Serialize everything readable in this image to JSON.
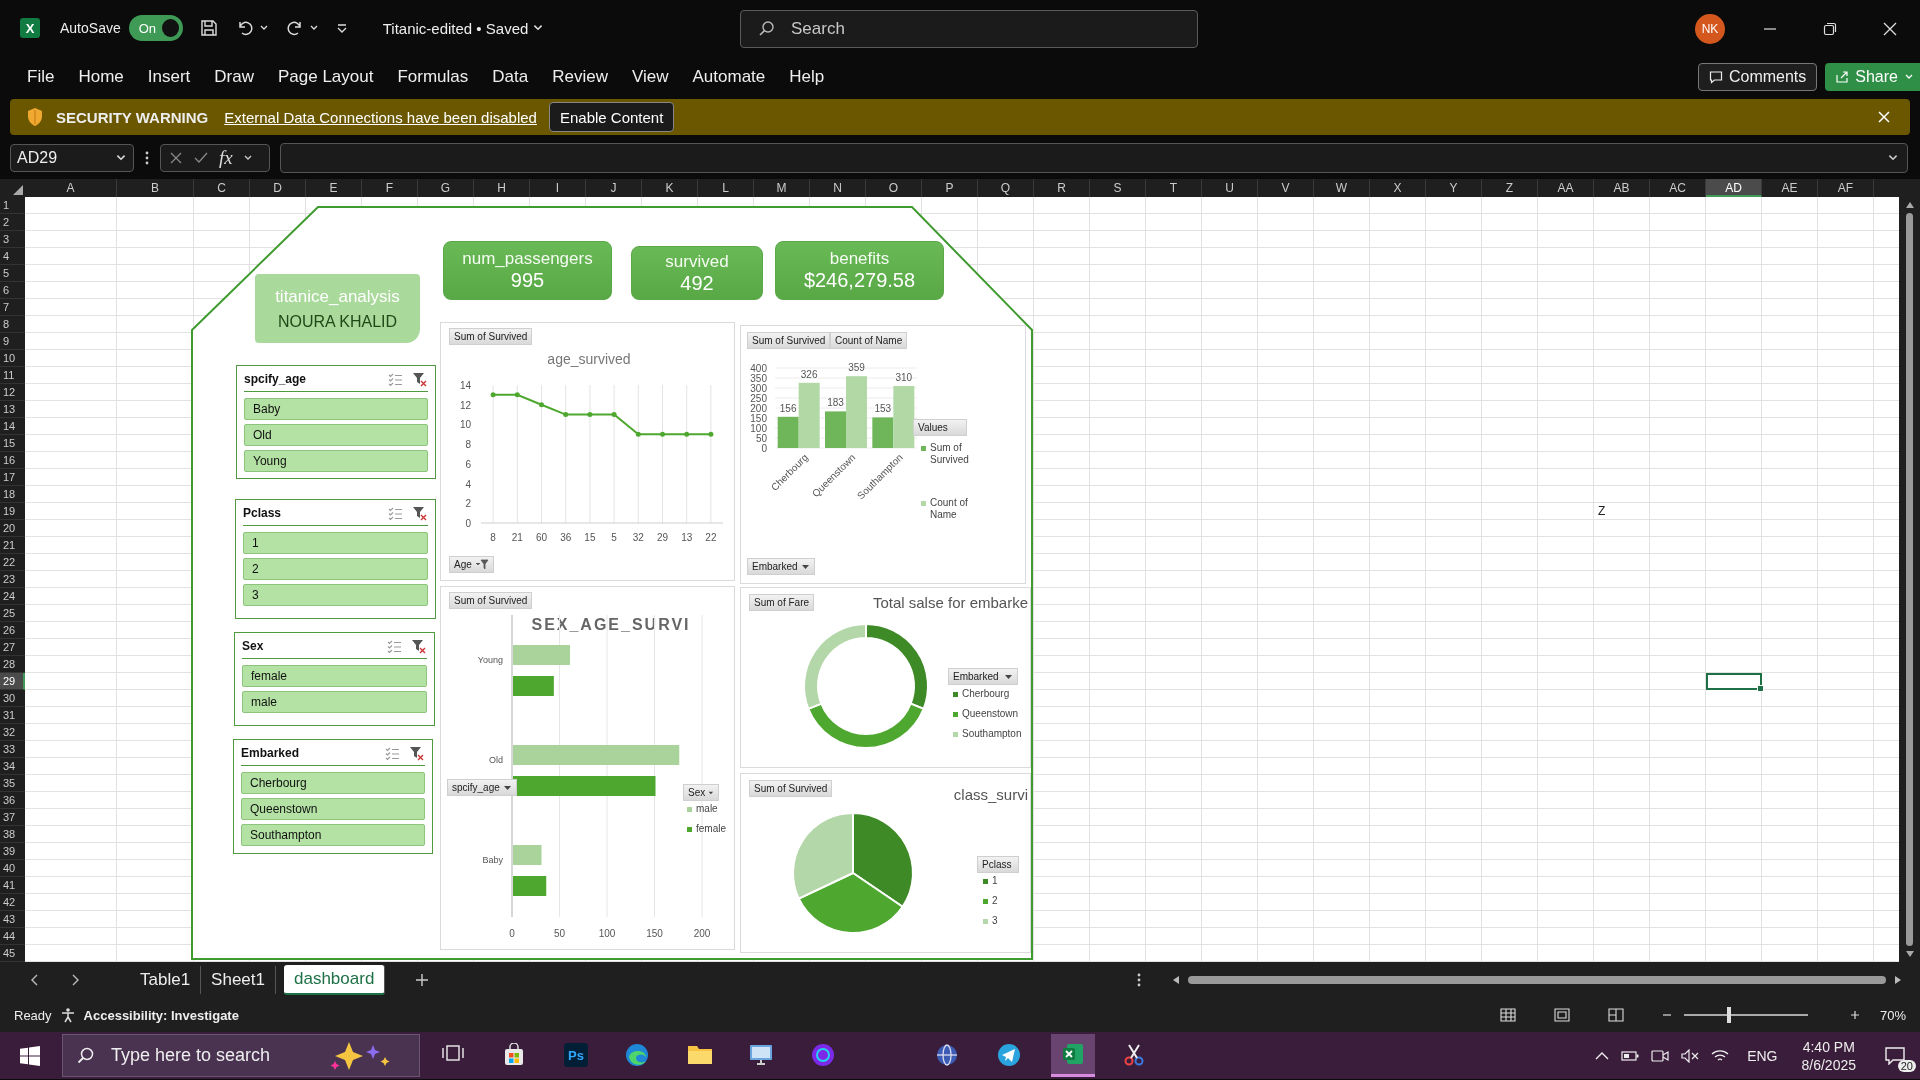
{
  "title_bar": {
    "app_icon_text": "X",
    "autosave": {
      "label": "AutoSave",
      "toggle_text": "On",
      "on": true
    },
    "document_title": "Titanic-edited • Saved",
    "search": {
      "placeholder": "Search"
    },
    "avatar": "NK"
  },
  "menu": [
    "File",
    "Home",
    "Insert",
    "Draw",
    "Page Layout",
    "Formulas",
    "Data",
    "Review",
    "View",
    "Automate",
    "Help"
  ],
  "menu_buttons": {
    "comments": "Comments",
    "share": "Share"
  },
  "security_warning": {
    "title": "SECURITY WARNING",
    "message": "External Data Connections have been disabled",
    "button": "Enable Content"
  },
  "formula_bar": {
    "name_box": "AD29",
    "function_label": "fx"
  },
  "columns": [
    {
      "label": "A",
      "selected": false
    },
    {
      "label": "B",
      "selected": false
    },
    {
      "label": "C",
      "selected": false
    },
    {
      "label": "D",
      "selected": false
    },
    {
      "label": "E",
      "selected": false
    },
    {
      "label": "F",
      "selected": false
    },
    {
      "label": "G",
      "selected": false
    },
    {
      "label": "H",
      "selected": false
    },
    {
      "label": "I",
      "selected": false
    },
    {
      "label": "J",
      "selected": false
    },
    {
      "label": "K",
      "selected": false
    },
    {
      "label": "L",
      "selected": false
    },
    {
      "label": "M",
      "selected": false
    },
    {
      "label": "N",
      "selected": false
    },
    {
      "label": "O",
      "selected": false
    },
    {
      "label": "P",
      "selected": false
    },
    {
      "label": "Q",
      "selected": false
    },
    {
      "label": "R",
      "selected": false
    },
    {
      "label": "S",
      "selected": false
    },
    {
      "label": "T",
      "selected": false
    },
    {
      "label": "U",
      "selected": false
    },
    {
      "label": "V",
      "selected": false
    },
    {
      "label": "W",
      "selected": false
    },
    {
      "label": "X",
      "selected": false
    },
    {
      "label": "Y",
      "selected": false
    },
    {
      "label": "Z",
      "selected": false
    },
    {
      "label": "AA",
      "selected": false
    },
    {
      "label": "AB",
      "selected": false
    },
    {
      "label": "AC",
      "selected": false
    },
    {
      "label": "AD",
      "selected": true
    },
    {
      "label": "AE",
      "selected": false
    },
    {
      "label": "AF",
      "selected": false
    }
  ],
  "rows": [
    {
      "label": "1",
      "selected": false
    },
    {
      "label": "2",
      "selected": false
    },
    {
      "label": "3",
      "selected": false
    },
    {
      "label": "4",
      "selected": false
    },
    {
      "label": "5",
      "selected": false
    },
    {
      "label": "6",
      "selected": false
    },
    {
      "label": "7",
      "selected": false
    },
    {
      "label": "8",
      "selected": false
    },
    {
      "label": "9",
      "selected": false
    },
    {
      "label": "10",
      "selected": false
    },
    {
      "label": "11",
      "selected": false
    },
    {
      "label": "12",
      "selected": false
    },
    {
      "label": "13",
      "selected": false
    },
    {
      "label": "14",
      "selected": false
    },
    {
      "label": "15",
      "selected": false
    },
    {
      "label": "16",
      "selected": false
    },
    {
      "label": "17",
      "selected": false
    },
    {
      "label": "18",
      "selected": false
    },
    {
      "label": "19",
      "selected": false
    },
    {
      "label": "20",
      "selected": false
    },
    {
      "label": "21",
      "selected": false
    },
    {
      "label": "22",
      "selected": false
    },
    {
      "label": "23",
      "selected": false
    },
    {
      "label": "24",
      "selected": false
    },
    {
      "label": "25",
      "selected": false
    },
    {
      "label": "26",
      "selected": false
    },
    {
      "label": "27",
      "selected": false
    },
    {
      "label": "28",
      "selected": false
    },
    {
      "label": "29",
      "selected": true
    },
    {
      "label": "30",
      "selected": false
    },
    {
      "label": "31",
      "selected": false
    },
    {
      "label": "32",
      "selected": false
    },
    {
      "label": "33",
      "selected": false
    },
    {
      "label": "34",
      "selected": false
    },
    {
      "label": "35",
      "selected": false
    },
    {
      "label": "36",
      "selected": false
    },
    {
      "label": "37",
      "selected": false
    },
    {
      "label": "38",
      "selected": false
    },
    {
      "label": "39",
      "selected": false
    },
    {
      "label": "40",
      "selected": false
    },
    {
      "label": "41",
      "selected": false
    },
    {
      "label": "42",
      "selected": false
    },
    {
      "label": "43",
      "selected": false
    },
    {
      "label": "44",
      "selected": false
    },
    {
      "label": "45",
      "selected": false
    }
  ],
  "sheet_cells": [
    {
      "value": "Z"
    }
  ],
  "dashboard": {
    "title": "titanice_analysis",
    "author": "NOURA KHALID",
    "kpis": [
      {
        "label": "num_passengers",
        "value": "995"
      },
      {
        "label": "survived",
        "value": "492"
      },
      {
        "label": "benefits",
        "value": "$246,279.58"
      }
    ],
    "slicers": [
      {
        "title": "spcify_age",
        "items": [
          {
            "label": "Baby",
            "selected": true
          },
          {
            "label": "Old",
            "selected": true
          },
          {
            "label": "Young",
            "selected": true
          }
        ]
      },
      {
        "title": "Pclass",
        "items": [
          {
            "label": "1",
            "selected": true
          },
          {
            "label": "2",
            "selected": true
          },
          {
            "label": "3",
            "selected": true
          }
        ]
      },
      {
        "title": "Sex",
        "items": [
          {
            "label": "female",
            "selected": true
          },
          {
            "label": "male",
            "selected": true
          }
        ]
      },
      {
        "title": "Embarked",
        "items": [
          {
            "label": "Cherbourg",
            "selected": true
          },
          {
            "label": "Queenstown",
            "selected": true
          },
          {
            "label": "Southampton",
            "selected": true
          }
        ]
      }
    ]
  },
  "age_chart": {
    "axis_field": "Age",
    "chart_data": {
      "type": "line",
      "title": "age_survived",
      "grid": true,
      "categories": [
        "8",
        "21",
        "60",
        "36",
        "15",
        "5",
        "32",
        "29",
        "13",
        "22"
      ],
      "ylim": [
        0,
        14
      ],
      "yticks": [
        0,
        2,
        4,
        6,
        8,
        10,
        12,
        14
      ],
      "series": [
        {
          "name": "Sum of Survived",
          "color": "#4ea72e",
          "values": [
            13,
            13,
            12,
            11,
            11,
            11,
            9,
            9,
            9,
            9
          ]
        }
      ]
    }
  },
  "embarked_chart": {
    "value_fields": [
      "Sum of Survived",
      "Count of Name"
    ],
    "axis_field": "Embarked",
    "legend_title": "Values",
    "chart_data": {
      "type": "bar",
      "categories": [
        "Cherbourg",
        "Queenstown",
        "Southampton"
      ],
      "ylim": [
        0,
        400
      ],
      "yticks": [
        0,
        50,
        100,
        150,
        200,
        250,
        300,
        350,
        400
      ],
      "data_labels": true,
      "grid": true,
      "legend": true,
      "series": [
        {
          "name": "Sum of Survived",
          "color": "#6fb55a",
          "values": [
            156,
            183,
            153
          ]
        },
        {
          "name": "Count of Name",
          "color": "#b2d8a6",
          "values": [
            326,
            359,
            310
          ]
        }
      ]
    }
  },
  "sex_age_chart": {
    "value_field": "Sum of Survived",
    "axis_field": "spcify_age",
    "legend_field": "Sex",
    "chart_data": {
      "type": "bar",
      "orientation": "horizontal",
      "title": "SEX_AGE_SURVI",
      "categories": [
        "Young",
        "Old",
        "Baby"
      ],
      "xlim": [
        0,
        200
      ],
      "xticks": [
        0,
        50,
        100,
        150,
        200
      ],
      "grid": true,
      "legend": true,
      "series": [
        {
          "name": "male",
          "color": "#a9d39a",
          "values": [
            60,
            175,
            30
          ]
        },
        {
          "name": "female",
          "color": "#4ea72e",
          "values": [
            43,
            150,
            35
          ]
        }
      ]
    }
  },
  "fare_chart": {
    "value_field": "Sum of Fare",
    "title": "Total salse for embarke",
    "legend_field": "Embarked",
    "legend": [
      {
        "label": "Cherbourg",
        "color": "#3d8a26"
      },
      {
        "label": "Queenstown",
        "color": "#4ea72e"
      },
      {
        "label": "Southampton",
        "color": "#b3d7a8"
      }
    ]
  },
  "class_chart": {
    "value_field": "Sum of Survived",
    "title": "class_survi",
    "legend_field": "Pclass",
    "legend": [
      {
        "label": "1",
        "color": "#3d8a26"
      },
      {
        "label": "2",
        "color": "#4ea72e"
      },
      {
        "label": "3",
        "color": "#b3d7a8"
      }
    ]
  },
  "sheet_tabs": [
    {
      "label": "Table1",
      "selected": false
    },
    {
      "label": "Sheet1",
      "selected": false
    },
    {
      "label": "dashboard",
      "selected": true
    }
  ],
  "status_bar": {
    "status": "Ready",
    "accessibility": "Accessibility: Investigate",
    "zoom": "70%",
    "zoom_slider": {
      "level": 0.36
    }
  },
  "taskbar": {
    "search_placeholder": "Type here to search",
    "photoshop_text": "Ps",
    "language": "ENG",
    "time": "4:40 PM",
    "date": "8/6/2025",
    "notifications": "20"
  }
}
